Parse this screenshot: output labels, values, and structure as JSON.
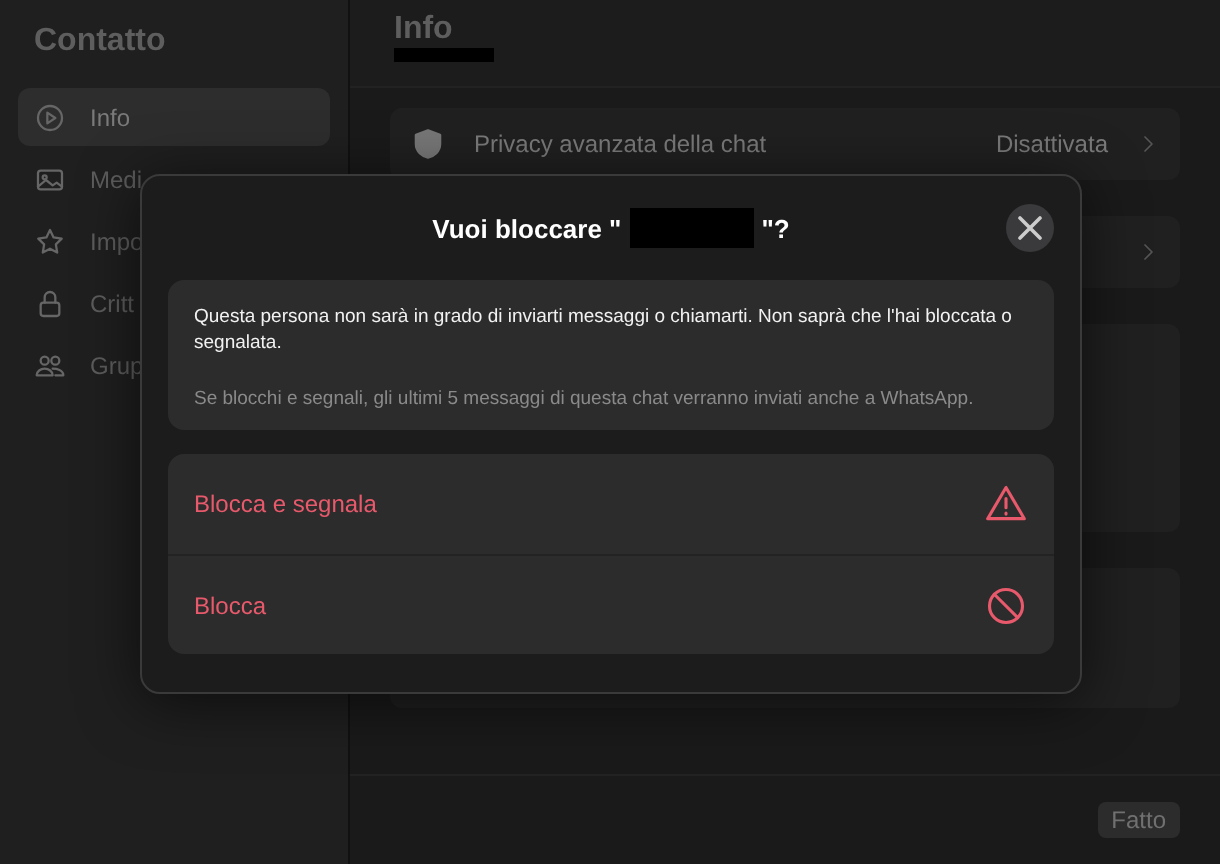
{
  "sidebar": {
    "title": "Contatto",
    "items": [
      {
        "label": "Info",
        "selected": true
      },
      {
        "label": "Medi",
        "selected": false
      },
      {
        "label": "Impo",
        "selected": false
      },
      {
        "label": "Critt",
        "selected": false
      },
      {
        "label": "Grup",
        "selected": false
      }
    ]
  },
  "main": {
    "title": "Info",
    "rows": [
      {
        "label": "Privacy avanzata della chat",
        "value": "Disattivata"
      }
    ],
    "done_button": "Fatto"
  },
  "dialog": {
    "title_before": "Vuoi bloccare \"",
    "title_after": "\"?",
    "message": "Questa persona non sarà in grado di inviarti messaggi o chiamarti. Non saprà che l'hai bloccata o segnalata.",
    "note": "Se blocchi e segnali, gli ultimi 5 messaggi di questa chat verranno inviati anche a WhatsApp.",
    "actions": [
      {
        "label": "Blocca e segnala",
        "kind": "report"
      },
      {
        "label": "Blocca",
        "kind": "block"
      }
    ]
  }
}
